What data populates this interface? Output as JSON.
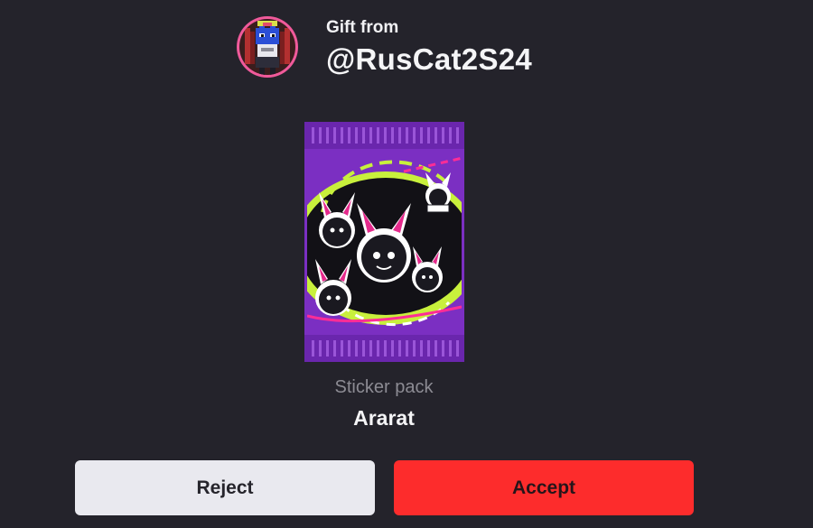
{
  "sender": {
    "label": "Gift from",
    "username": "@RusCat2S24",
    "avatar_icon": "pixel-cat-avatar"
  },
  "item": {
    "type": "Sticker pack",
    "name": "Ararat",
    "artwork_icon": "sticker-pack-artwork",
    "pack_color": "#7a2fc0",
    "accent_color": "#c8f03c"
  },
  "actions": {
    "reject_label": "Reject",
    "accept_label": "Accept",
    "accept_color": "#fd2c2c",
    "reject_color": "#e9e9ef"
  },
  "theme": {
    "background": "#24232b"
  }
}
